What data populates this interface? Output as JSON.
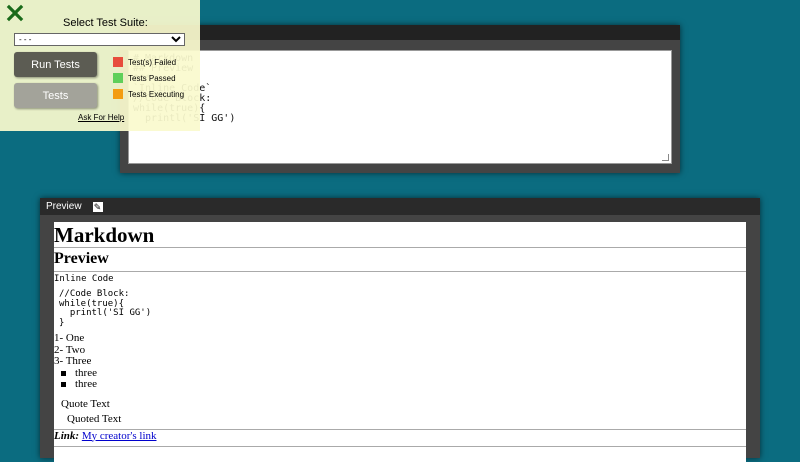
{
  "editor": {
    "lines": [
      "# Markdown",
      "## Preview",
      "***",
      "`Inline Code`",
      "",
      "",
      "//Code Block:",
      "while(true){",
      "  printl('SI GG')"
    ]
  },
  "preview": {
    "header_label": "Preview",
    "edit_icon": "pencil-icon",
    "h1": "Markdown",
    "h2": "Preview",
    "inline_code": "Inline Code",
    "code_lines": [
      "//Code Block:",
      "while(true){",
      "  printl('SI GG')",
      "}"
    ],
    "ordered_items": [
      "1- One",
      "2- Two",
      "3- Three"
    ],
    "bullet_items": [
      "three",
      "three"
    ],
    "quote": "Quote Text",
    "nested_quote": "Quoted Text",
    "link_label": "Link:",
    "link_text": "My creator's link"
  },
  "test_panel": {
    "close_icon": "close-icon",
    "title": "Select Test Suite:",
    "select_value": "- - -",
    "run_label": "Run Tests",
    "tests_label": "Tests",
    "legend": [
      {
        "label": "Test(s) Failed",
        "color": "#e74c3c"
      },
      {
        "label": "Tests Passed",
        "color": "#5fcf5a"
      },
      {
        "label": "Tests Executing",
        "color": "#f39c12"
      }
    ],
    "help_link": "Ask For Help"
  },
  "colors": {
    "background": "#0b6c80",
    "panel": "#fafacd",
    "close_icon": "#1a6b1a"
  }
}
